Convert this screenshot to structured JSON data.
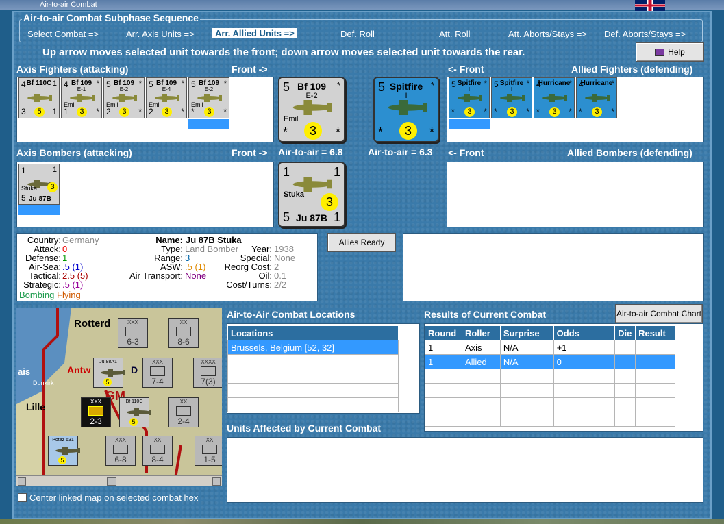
{
  "window": {
    "title": "Air-to-air Combat"
  },
  "sequence": {
    "title": "Air-to-air Combat Subphase Sequence",
    "steps": [
      {
        "label": "Select Combat =>"
      },
      {
        "label": "Arr. Axis Units =>"
      },
      {
        "label": "Arr. Allied Units =>"
      },
      {
        "label": "Def. Roll"
      },
      {
        "label": "Att. Roll"
      },
      {
        "label": "Att. Aborts/Stays =>"
      },
      {
        "label": "Def. Aborts/Stays =>"
      }
    ],
    "active_index": 2
  },
  "instruction": "Up arrow moves selected unit towards the front; down arrow moves selected unit towards the rear.",
  "help_button": {
    "label": "Help",
    "icon": "book-icon"
  },
  "axis_fighters": {
    "title": "Axis Fighters (attacking)",
    "front_label": "Front ->",
    "units": [
      {
        "top_left": "4",
        "name": "Bf 110C",
        "sub": "",
        "mid": "",
        "bottom_left": "3",
        "rating": "5",
        "bottom_right": "1",
        "top_right": "1"
      },
      {
        "top_left": "4",
        "name": "Bf 109",
        "sub": "E-1",
        "mid": "Emil",
        "bottom_left": "1",
        "rating": "3",
        "bottom_right": "*",
        "top_right": "*"
      },
      {
        "top_left": "5",
        "name": "Bf 109",
        "sub": "E-2",
        "mid": "Emil",
        "bottom_left": "2",
        "rating": "3",
        "bottom_right": "*",
        "top_right": "*"
      },
      {
        "top_left": "5",
        "name": "Bf 109",
        "sub": "E-4",
        "mid": "Emil",
        "bottom_left": "2",
        "rating": "3",
        "bottom_right": "*",
        "top_right": "*"
      },
      {
        "top_left": "5",
        "name": "Bf 109",
        "sub": "E-2",
        "mid": "Emil",
        "bottom_left": "*",
        "rating": "3",
        "bottom_right": "*",
        "top_right": "*"
      }
    ]
  },
  "axis_fighter_big": {
    "top_left": "5",
    "name": "Bf 109",
    "sub": "E-2",
    "mid": "Emil",
    "bottom_left": "*",
    "rating": "3",
    "bottom_right": "*",
    "top_right": "*"
  },
  "axis_air_to_air": "Air-to-air = 6.8",
  "allied_fighter_big": {
    "top_left": "5",
    "name": "Spitfire",
    "sub": "I",
    "bottom_left": "*",
    "rating": "3",
    "bottom_right": "*",
    "top_right": "*"
  },
  "allied_air_to_air": "Air-to-air = 6.3",
  "allied_fighters": {
    "title": "Allied Fighters (defending)",
    "front_label": "<- Front",
    "units": [
      {
        "top_left": "5",
        "name": "Spitfire",
        "sub": "I",
        "bottom_left": "*",
        "rating": "3",
        "bottom_right": "*",
        "top_right": "*"
      },
      {
        "top_left": "5",
        "name": "Spitfire",
        "sub": "I",
        "bottom_left": "*",
        "rating": "3",
        "bottom_right": "*",
        "top_right": "*"
      },
      {
        "top_left": "4",
        "name": "Hurricane",
        "sub": "",
        "bottom_left": "*",
        "rating": "3",
        "bottom_right": "*",
        "top_right": "*"
      },
      {
        "top_left": "4",
        "name": "Hurricane",
        "sub": "",
        "bottom_left": "*",
        "rating": "3",
        "bottom_right": "*",
        "top_right": "*"
      }
    ]
  },
  "axis_bombers": {
    "title": "Axis Bombers (attacking)",
    "front_label": "Front ->",
    "units": [
      {
        "top_left": "1",
        "top_right": "1",
        "mid": "Stuka",
        "bottom_left": "5",
        "name": "Ju 87B",
        "bottom_right": "1",
        "rating": "3"
      }
    ]
  },
  "axis_bomber_big": {
    "top_left": "1",
    "top_right": "1",
    "mid": "Stuka",
    "bottom_left": "5",
    "name": "Ju 87B",
    "bottom_right": "1",
    "rating": "3"
  },
  "allied_bombers": {
    "title": "Allied Bombers (defending)",
    "front_label": "<- Front"
  },
  "unit_info": {
    "country_label": "Country:",
    "country": "Germany",
    "attack_label": "Attack:",
    "attack": "0",
    "defense_label": "Defense:",
    "defense": "1",
    "airsea_label": "Air-Sea:",
    "airsea": ".5 (1)",
    "tactical_label": "Tactical:",
    "tactical": "2.5 (5)",
    "strategic_label": "Strategic:",
    "strategic": ".5 (1)",
    "flag_bombing": "Bombing",
    "flag_flying": "Flying",
    "name_label": "Name:",
    "name": "Ju 87B Stuka",
    "type_label": "Type:",
    "type": "Land Bomber",
    "year_label": "Year:",
    "year": "1938",
    "range_label": "Range:",
    "range": "3",
    "special_label": "Special:",
    "special": "None",
    "asw_label": "ASW:",
    "asw": ".5 (1)",
    "reorg_label": "Reorg Cost:",
    "reorg": "2",
    "oil_label": "Oil:",
    "oil": "0.1",
    "airtransport_label": "Air Transport:",
    "airtransport": "None",
    "cost_label": "Cost/Turns:",
    "cost": "2/2"
  },
  "allies_ready_button": "Allies Ready",
  "map": {
    "labels": {
      "rotterdam": "Rotterd",
      "antwerp": "Antw",
      "dunkirk": "Dunkirk",
      "lille": "Lille",
      "ais": "ais",
      "ys": "D",
      "gm": "GM"
    },
    "counters": [
      {
        "top": "XXX",
        "val": "6-3"
      },
      {
        "top": "XX",
        "val": "8-6"
      },
      {
        "top": "XXX",
        "val": "7-4"
      },
      {
        "top": "XXXX",
        "val": "7(3)"
      },
      {
        "top": "XXX",
        "val": "2-3"
      },
      {
        "top": "XX",
        "val": "2-4"
      },
      {
        "top": "XXX",
        "val": "6-8"
      },
      {
        "top": "XX",
        "val": "8-4"
      },
      {
        "top": "XX",
        "val": "1-5"
      }
    ],
    "air_counters": [
      {
        "name": "Ju 88A1",
        "rating": "5"
      },
      {
        "name": "Bf 110C",
        "rating": "5"
      },
      {
        "name": "Potez 631",
        "rating": "5"
      }
    ]
  },
  "center_map_checkbox": {
    "label": "Center linked map on selected combat hex",
    "checked": false
  },
  "locations": {
    "title": "Air-to-Air Combat Locations",
    "header": "Locations",
    "rows": [
      "Brussels, Belgium [52, 32]"
    ]
  },
  "results": {
    "title": "Results of Current Combat",
    "chart_button": "Air-to-air Combat Chart",
    "columns": [
      "Round",
      "Roller",
      "Surprise",
      "Odds",
      "Die",
      "Result"
    ],
    "rows": [
      [
        "1",
        "Axis",
        "N/A",
        "+1",
        "",
        ""
      ],
      [
        "1",
        "Allied",
        "N/A",
        "0",
        "",
        ""
      ]
    ]
  },
  "units_affected": {
    "title": "Units Affected by Current Combat"
  },
  "colors": {
    "accent": "#3399ff",
    "allied": "#2c8fd0",
    "axis": "#d2d2d2",
    "rating": "#ffef00"
  }
}
